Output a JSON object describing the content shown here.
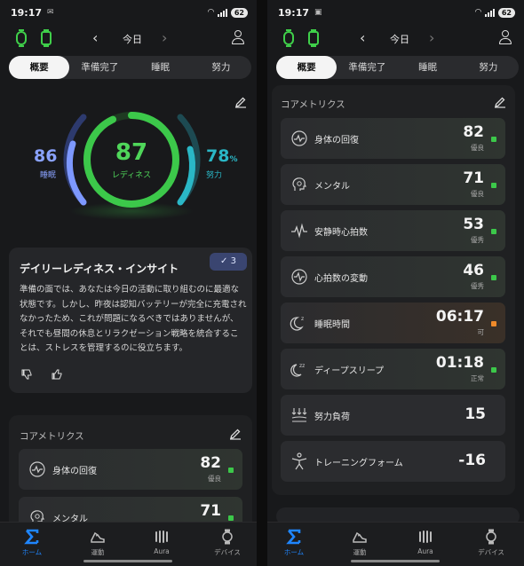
{
  "status_bar": {
    "time": "19:17",
    "battery": "62"
  },
  "header": {
    "date_label": "今日"
  },
  "tabs": [
    "概要",
    "準備完了",
    "睡眠",
    "努力"
  ],
  "readiness": {
    "value": "87",
    "label": "レディネス",
    "sleep_value": "86",
    "sleep_label": "睡眠",
    "effort_value": "78",
    "effort_unit": "%",
    "effort_label": "努力"
  },
  "insight": {
    "title": "デイリーレディネス・インサイト",
    "badge_count": "3",
    "body": "準備の面では、あなたは今日の活動に取り組むのに最適な状態です。しかし、昨夜は認知バッテリーが完全に充電されなかったため、これが問題になるべきではありませんが、それでも昼間の休息とリラクゼーション戦略を統合することは、ストレスを管理するのに役立ちます。"
  },
  "core_metrics": {
    "title": "コアメトリクス",
    "items": [
      {
        "label": "身体の回復",
        "value": "82",
        "status": "優良",
        "icon": "recovery-wave-icon",
        "dot": "#3cc84a"
      },
      {
        "label": "メンタル",
        "value": "71",
        "status": "優良",
        "icon": "head-brain-icon",
        "dot": "#3cc84a"
      },
      {
        "label": "安静時心拍数",
        "value": "53",
        "status": "優秀",
        "icon": "heartbeat-line-icon",
        "dot": "#3cc84a"
      },
      {
        "label": "心拍数の変動",
        "value": "46",
        "status": "優秀",
        "icon": "hrv-circle-icon",
        "dot": "#3cc84a"
      },
      {
        "label": "睡眠時間",
        "value": "06:17",
        "status": "可",
        "icon": "sleep-moon-icon",
        "dot": "#ef8a2a"
      },
      {
        "label": "ディープスリープ",
        "value": "01:18",
        "status": "正常",
        "icon": "deep-sleep-icon",
        "dot": "#3cc84a"
      },
      {
        "label": "努力負荷",
        "value": "15",
        "status": "",
        "icon": "load-arrows-icon",
        "dot": ""
      },
      {
        "label": "トレーニングフォーム",
        "value": "-16",
        "status": "",
        "icon": "training-form-icon",
        "dot": ""
      }
    ]
  },
  "bottom_nav": [
    {
      "label": "ホーム",
      "icon": "sigma-home-icon",
      "active": true
    },
    {
      "label": "運動",
      "icon": "running-shoe-icon",
      "active": false
    },
    {
      "label": "Aura",
      "icon": "aura-icon",
      "active": false
    },
    {
      "label": "デバイス",
      "icon": "watch-device-icon",
      "active": false
    }
  ],
  "colors": {
    "accent_green": "#3cc84a",
    "accent_blue": "#1f86ff",
    "sleep_blue": "#6c8cff",
    "effort_teal": "#2ab7c6",
    "warning_orange": "#ef8a2a"
  }
}
